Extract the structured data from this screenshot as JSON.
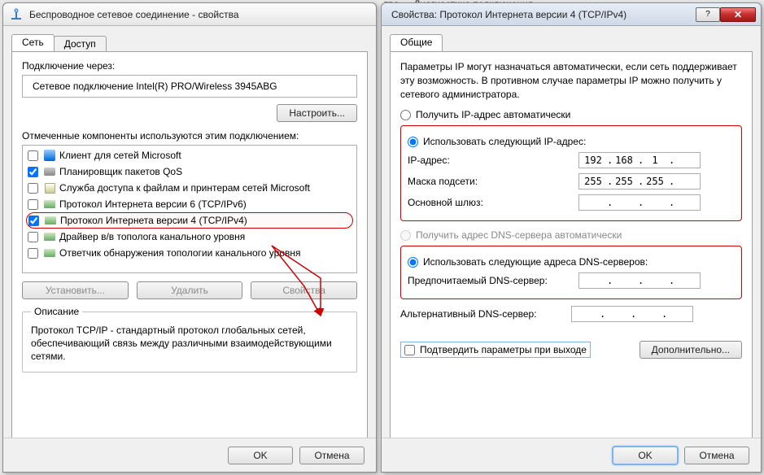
{
  "bg_tabs": [
    "тва",
    "Диагностика подключения"
  ],
  "left": {
    "title": "Беспроводное сетевое соединение - свойства",
    "tabs": {
      "net": "Сеть",
      "access": "Доступ"
    },
    "connect_via_label": "Подключение через:",
    "adapter": "Сетевое подключение Intel(R) PRO/Wireless 3945ABG",
    "configure": "Настроить...",
    "components_label": "Отмеченные компоненты используются этим подключением:",
    "items": [
      {
        "checked": false,
        "label": "Клиент для сетей Microsoft"
      },
      {
        "checked": true,
        "label": "Планировщик пакетов QoS"
      },
      {
        "checked": false,
        "label": "Служба доступа к файлам и принтерам сетей Microsoft"
      },
      {
        "checked": false,
        "label": "Протокол Интернета версии 6 (TCP/IPv6)"
      },
      {
        "checked": true,
        "label": "Протокол Интернета версии 4 (TCP/IPv4)",
        "highlight": true
      },
      {
        "checked": false,
        "label": "Драйвер в/в тополога канального уровня"
      },
      {
        "checked": false,
        "label": "Ответчик обнаружения топологии канального уровня"
      }
    ],
    "install": "Установить...",
    "remove": "Удалить",
    "properties": "Свойства",
    "desc_title": "Описание",
    "desc_text": "Протокол TCP/IP - стандартный протокол глобальных сетей, обеспечивающий связь между различными взаимодействующими сетями.",
    "ok": "OK",
    "cancel": "Отмена"
  },
  "right": {
    "title": "Свойства: Протокол Интернета версии 4 (TCP/IPv4)",
    "tab_general": "Общие",
    "info": "Параметры IP могут назначаться автоматически, если сеть поддерживает эту возможность. В противном случае параметры IP можно получить у сетевого администратора.",
    "ip_auto": "Получить IP-адрес автоматически",
    "ip_manual": "Использовать следующий IP-адрес:",
    "ip_addr_label": "IP-адрес:",
    "ip_addr": [
      "192",
      "168",
      "1",
      ""
    ],
    "mask_label": "Маска подсети:",
    "mask": [
      "255",
      "255",
      "255",
      ""
    ],
    "gateway_label": "Основной шлюз:",
    "gateway": [
      "",
      "",
      "",
      ""
    ],
    "dns_auto": "Получить адрес DNS-сервера автоматически",
    "dns_manual": "Использовать следующие адреса DNS-серверов:",
    "dns_pref_label": "Предпочитаемый DNS-сервер:",
    "dns_pref": [
      "",
      "",
      "",
      ""
    ],
    "dns_alt_label": "Альтернативный DNS-сервер:",
    "dns_alt": [
      "",
      "",
      "",
      ""
    ],
    "validate": "Подтвердить параметры при выходе",
    "advanced": "Дополнительно...",
    "ok": "OK",
    "cancel": "Отмена"
  }
}
